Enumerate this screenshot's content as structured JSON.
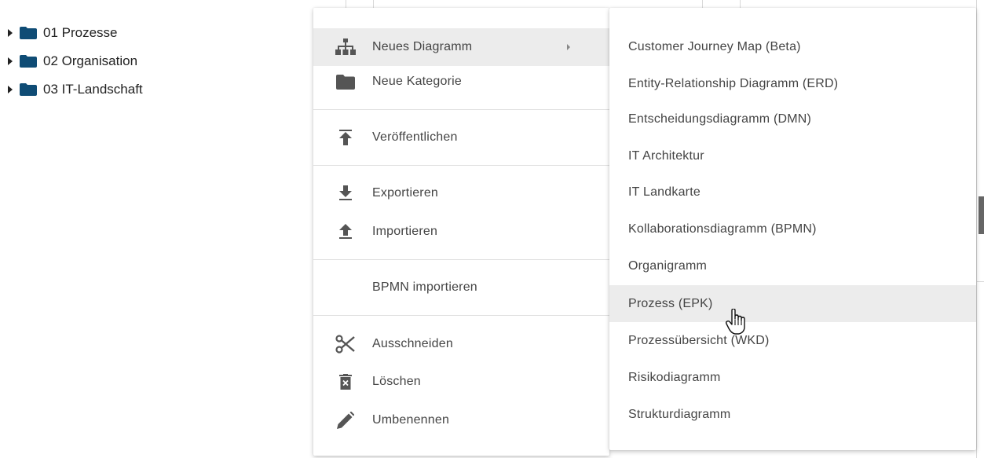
{
  "tree": {
    "items": [
      {
        "label": "01 Prozesse",
        "icon": "folder-icon"
      },
      {
        "label": "02 Organisation",
        "icon": "folder-icon"
      },
      {
        "label": "03 IT-Landschaft",
        "icon": "folder-icon"
      }
    ]
  },
  "context_menu": {
    "items": [
      {
        "label": "Neues Diagramm",
        "icon": "hierarchy-icon",
        "has_submenu": true,
        "active": true
      },
      {
        "label": "Neue Kategorie",
        "icon": "folder-icon"
      },
      {
        "label": "Veröffentlichen",
        "icon": "publish-icon"
      },
      {
        "label": "Exportieren",
        "icon": "download-icon"
      },
      {
        "label": "Importieren",
        "icon": "upload-icon"
      },
      {
        "label": "BPMN importieren",
        "icon": ""
      },
      {
        "label": "Ausschneiden",
        "icon": "scissors-icon"
      },
      {
        "label": "Löschen",
        "icon": "trash-icon"
      },
      {
        "label": "Umbenennen",
        "icon": "pencil-icon"
      }
    ]
  },
  "submenu": {
    "items": [
      "Customer Journey Map (Beta)",
      "Entity-Relationship Diagramm (ERD)",
      "Entscheidungsdiagramm (DMN)",
      "IT Architektur",
      "IT Landkarte",
      "Kollaborationsdiagramm (BPMN)",
      "Organigramm",
      "Prozess (EPK)",
      "Prozessübersicht (WKD)",
      "Risikodiagramm",
      "Strukturdiagramm"
    ],
    "hovered_item": "Prozess (EPK)"
  },
  "colors": {
    "folder": "#0f4c75",
    "icon": "#555555",
    "hover_bg": "#ececec"
  }
}
